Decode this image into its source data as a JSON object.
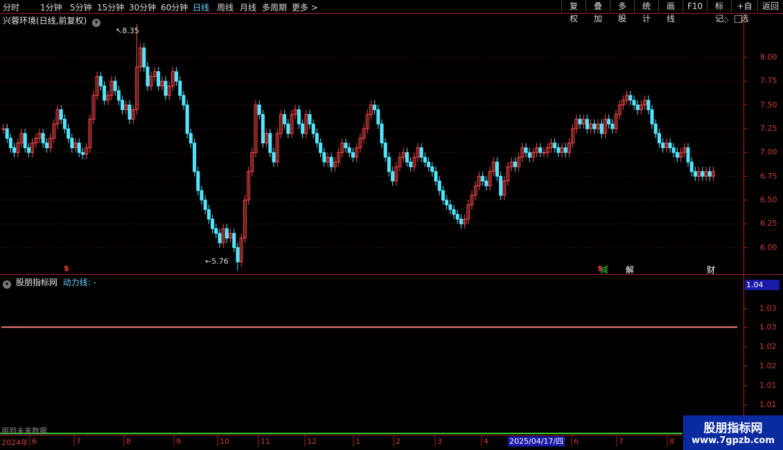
{
  "toolbar": {
    "periods": [
      {
        "label": "分时",
        "active": false
      },
      {
        "label": "1分钟",
        "active": false
      },
      {
        "label": "5分钟",
        "active": false
      },
      {
        "label": "15分钟",
        "active": false
      },
      {
        "label": "30分钟",
        "active": false
      },
      {
        "label": "60分钟",
        "active": false
      },
      {
        "label": "日线",
        "active": true
      },
      {
        "label": "周线",
        "active": false
      },
      {
        "label": "月线",
        "active": false
      },
      {
        "label": "多周期",
        "active": false
      },
      {
        "label": "更多 >",
        "active": false
      }
    ],
    "right_buttons": [
      "复权",
      "叠加",
      "多股",
      "统计",
      "画线",
      "F10",
      "标记",
      "+自选",
      "返回"
    ]
  },
  "main_chart": {
    "title": "兴蓉环境(日线,前复权)",
    "high_marker": "8.35",
    "low_marker": "5.76",
    "price_ticks": [
      "8.00",
      "7.75",
      "7.50",
      "7.25",
      "7.00",
      "6.75",
      "6.50",
      "6.25",
      "6.00"
    ],
    "event_flags": [
      {
        "label": "$",
        "color": "#ff3b3b"
      },
      {
        "label": "$",
        "color": "#ff3b3b"
      },
      {
        "label": "减",
        "color": "#2ecc40"
      },
      {
        "label": "解",
        "color": "#ffffff"
      },
      {
        "label": "财",
        "color": "#ffffff"
      }
    ]
  },
  "indicator": {
    "name": "股朋指标网",
    "line_label": "动力线: -",
    "current_value": "1.04",
    "ticks": [
      "1.03",
      "1.03",
      "1.02",
      "1.02",
      "1.01",
      "1.01"
    ],
    "line_color": "#ff8080",
    "line_value": 1.03
  },
  "footer": {
    "warning": "用到未来数据",
    "year_label": "2024年",
    "months": [
      "6",
      "7",
      "8",
      "9",
      "10",
      "11",
      "12",
      "1",
      "2",
      "3",
      "4",
      "6",
      "7",
      "8"
    ],
    "cursor_date": "2025/04/17/四",
    "watermark_title": "股朋指标网",
    "watermark_url": "www.7gpzb.com"
  },
  "colors": {
    "up": "#ff4a4a",
    "down": "#53e6ff",
    "axis": "#b32020",
    "grid": "#6e1b1b"
  },
  "chart_data": {
    "type": "candlestick",
    "title": "兴蓉环境(日线,前复权)",
    "ylim": [
      5.75,
      8.4
    ],
    "extremes": {
      "high": 8.35,
      "low": 5.76
    },
    "closes": [
      7.25,
      7.15,
      7.05,
      7.0,
      7.1,
      7.2,
      7.05,
      7.0,
      7.1,
      7.15,
      7.2,
      7.1,
      7.05,
      7.15,
      7.3,
      7.45,
      7.35,
      7.25,
      7.15,
      7.05,
      7.1,
      7.0,
      6.98,
      7.05,
      7.35,
      7.6,
      7.8,
      7.7,
      7.55,
      7.6,
      7.75,
      7.65,
      7.55,
      7.45,
      7.5,
      7.35,
      7.45,
      7.9,
      8.1,
      7.9,
      7.7,
      7.8,
      7.85,
      7.7,
      7.75,
      7.6,
      7.7,
      7.85,
      7.75,
      7.6,
      7.5,
      7.2,
      7.1,
      6.8,
      6.6,
      6.5,
      6.4,
      6.3,
      6.2,
      6.15,
      6.05,
      6.2,
      6.1,
      6.15,
      6.0,
      5.85,
      6.1,
      6.5,
      6.8,
      7.0,
      7.5,
      7.4,
      7.1,
      7.2,
      7.0,
      6.9,
      7.2,
      7.4,
      7.3,
      7.2,
      7.4,
      7.45,
      7.3,
      7.2,
      7.4,
      7.3,
      7.2,
      7.1,
      7.0,
      6.9,
      6.95,
      6.85,
      6.9,
      7.0,
      7.1,
      7.05,
      7.0,
      6.95,
      7.05,
      7.15,
      7.25,
      7.4,
      7.5,
      7.45,
      7.3,
      7.1,
      6.95,
      6.8,
      6.7,
      6.85,
      6.95,
      7.0,
      6.9,
      6.85,
      6.95,
      7.05,
      6.95,
      6.9,
      6.85,
      6.8,
      6.7,
      6.6,
      6.5,
      6.45,
      6.4,
      6.35,
      6.3,
      6.25,
      6.3,
      6.45,
      6.55,
      6.65,
      6.75,
      6.7,
      6.65,
      6.8,
      6.9,
      6.75,
      6.55,
      6.7,
      6.85,
      6.9,
      6.85,
      6.95,
      7.05,
      7.0,
      6.95,
      7.0,
      7.05,
      7.0,
      7.0,
      7.05,
      7.1,
      7.05,
      7.0,
      7.05,
      7.0,
      7.1,
      7.25,
      7.35,
      7.3,
      7.35,
      7.25,
      7.3,
      7.25,
      7.3,
      7.2,
      7.35,
      7.3,
      7.25,
      7.4,
      7.5,
      7.55,
      7.6,
      7.55,
      7.5,
      7.45,
      7.5,
      7.55,
      7.45,
      7.3,
      7.2,
      7.1,
      7.05,
      7.1,
      7.05,
      7.0,
      6.95,
      7.0,
      7.05,
      6.9,
      6.8,
      6.75,
      6.8,
      6.75,
      6.8,
      6.75,
      6.8
    ]
  }
}
